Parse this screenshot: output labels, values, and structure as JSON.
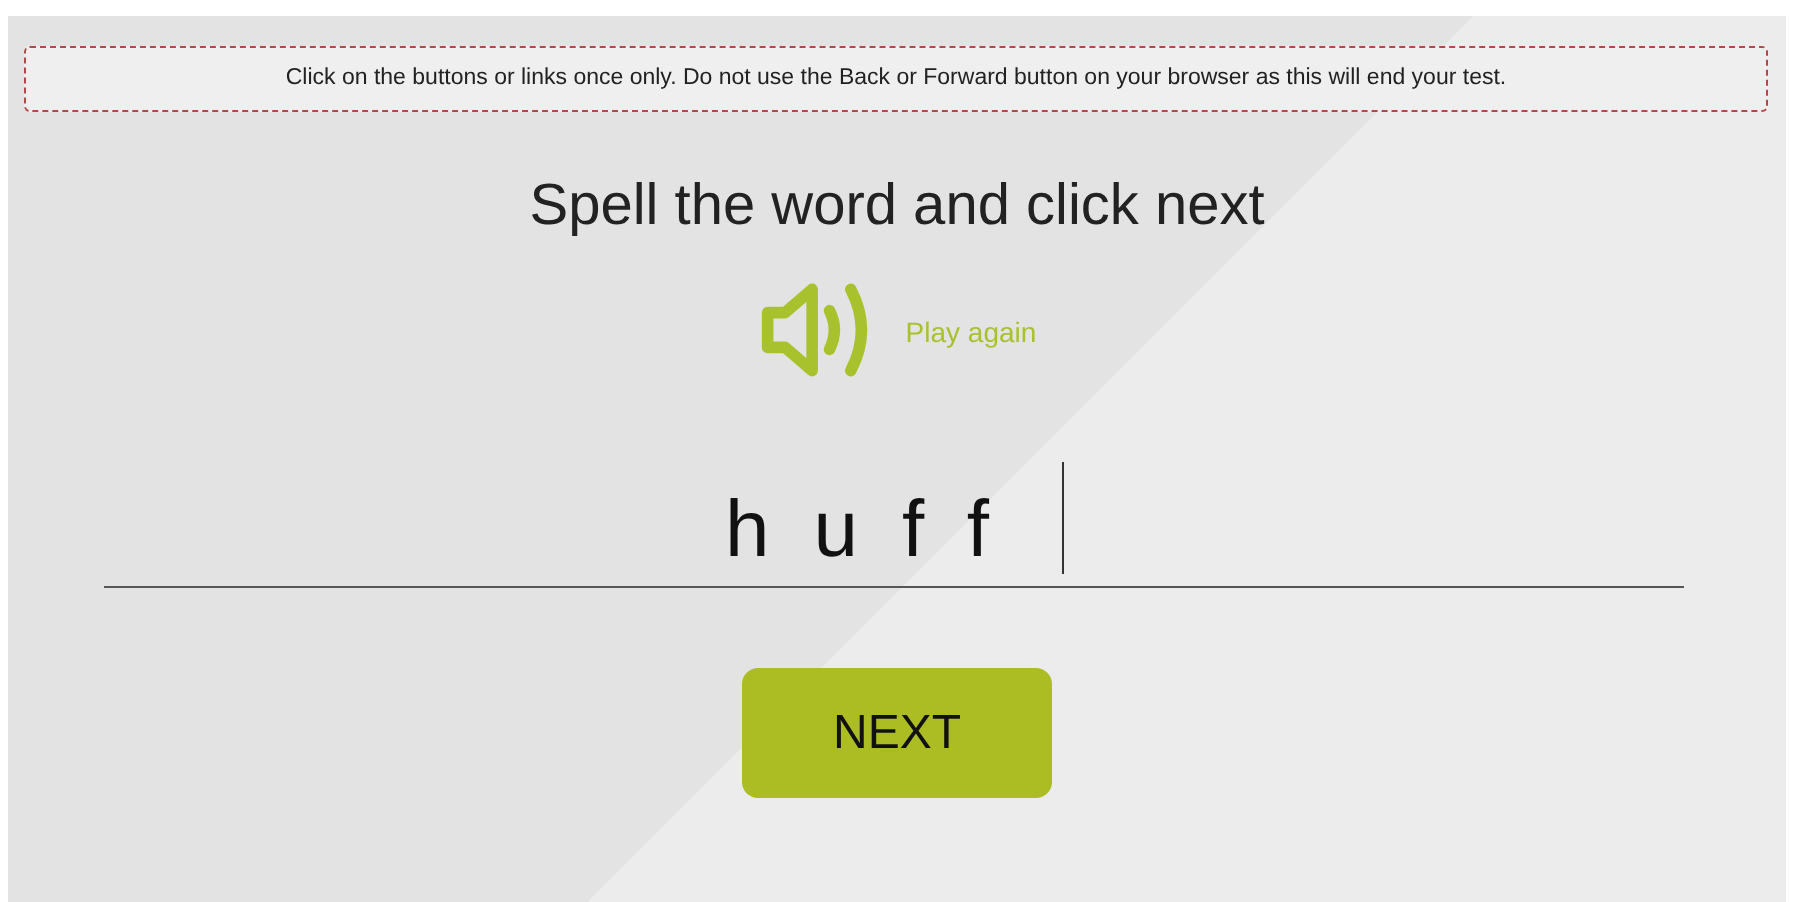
{
  "notice": "Click on the buttons or links once only. Do not use the Back or Forward button on your browser as this will end your test.",
  "heading": "Spell the word and click next",
  "audio": {
    "label": "Play again"
  },
  "answer": {
    "value": "huff",
    "focused": true
  },
  "buttons": [
    {
      "label": "NEXT"
    }
  ]
}
